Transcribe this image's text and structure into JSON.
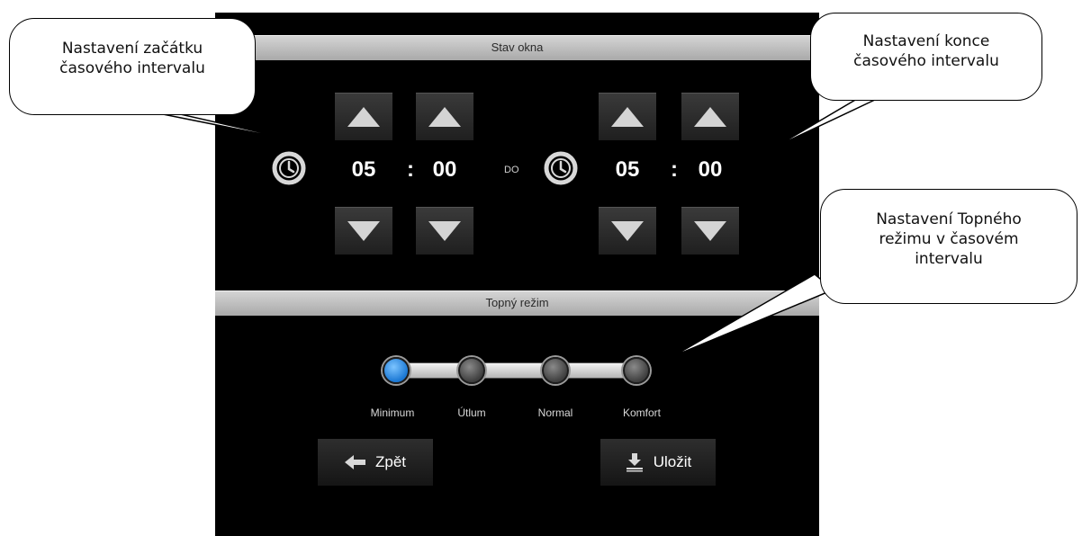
{
  "window_header": {
    "title": "Stav okna"
  },
  "time_interval": {
    "start": {
      "hours": "05",
      "minutes": "00"
    },
    "separator": ":",
    "connector": "DO",
    "end": {
      "hours": "05",
      "minutes": "00"
    },
    "clock_icon": "clock-icon",
    "up_icon": "triangle-up-icon",
    "down_icon": "triangle-down-icon"
  },
  "heating_section": {
    "title": "Topný režim"
  },
  "heating_mode": {
    "options": [
      "Minimum",
      "Útlum",
      "Normal",
      "Komfort"
    ],
    "selected": "Minimum",
    "selected_color": "#2f8fe6"
  },
  "buttons": {
    "back": {
      "label": "Zpět",
      "icon": "arrow-left-icon"
    },
    "save": {
      "label": "Uložit",
      "icon": "download-icon"
    }
  },
  "callouts": {
    "start": {
      "line1": "Nastavení začátku",
      "line2": "časového intervalu"
    },
    "end": {
      "line1": "Nastavení konce",
      "line2": "časového intervalu"
    },
    "mode": {
      "line1": "Nastavení Topného",
      "line2": "režimu v  časovém",
      "line3": "intervalu"
    }
  }
}
